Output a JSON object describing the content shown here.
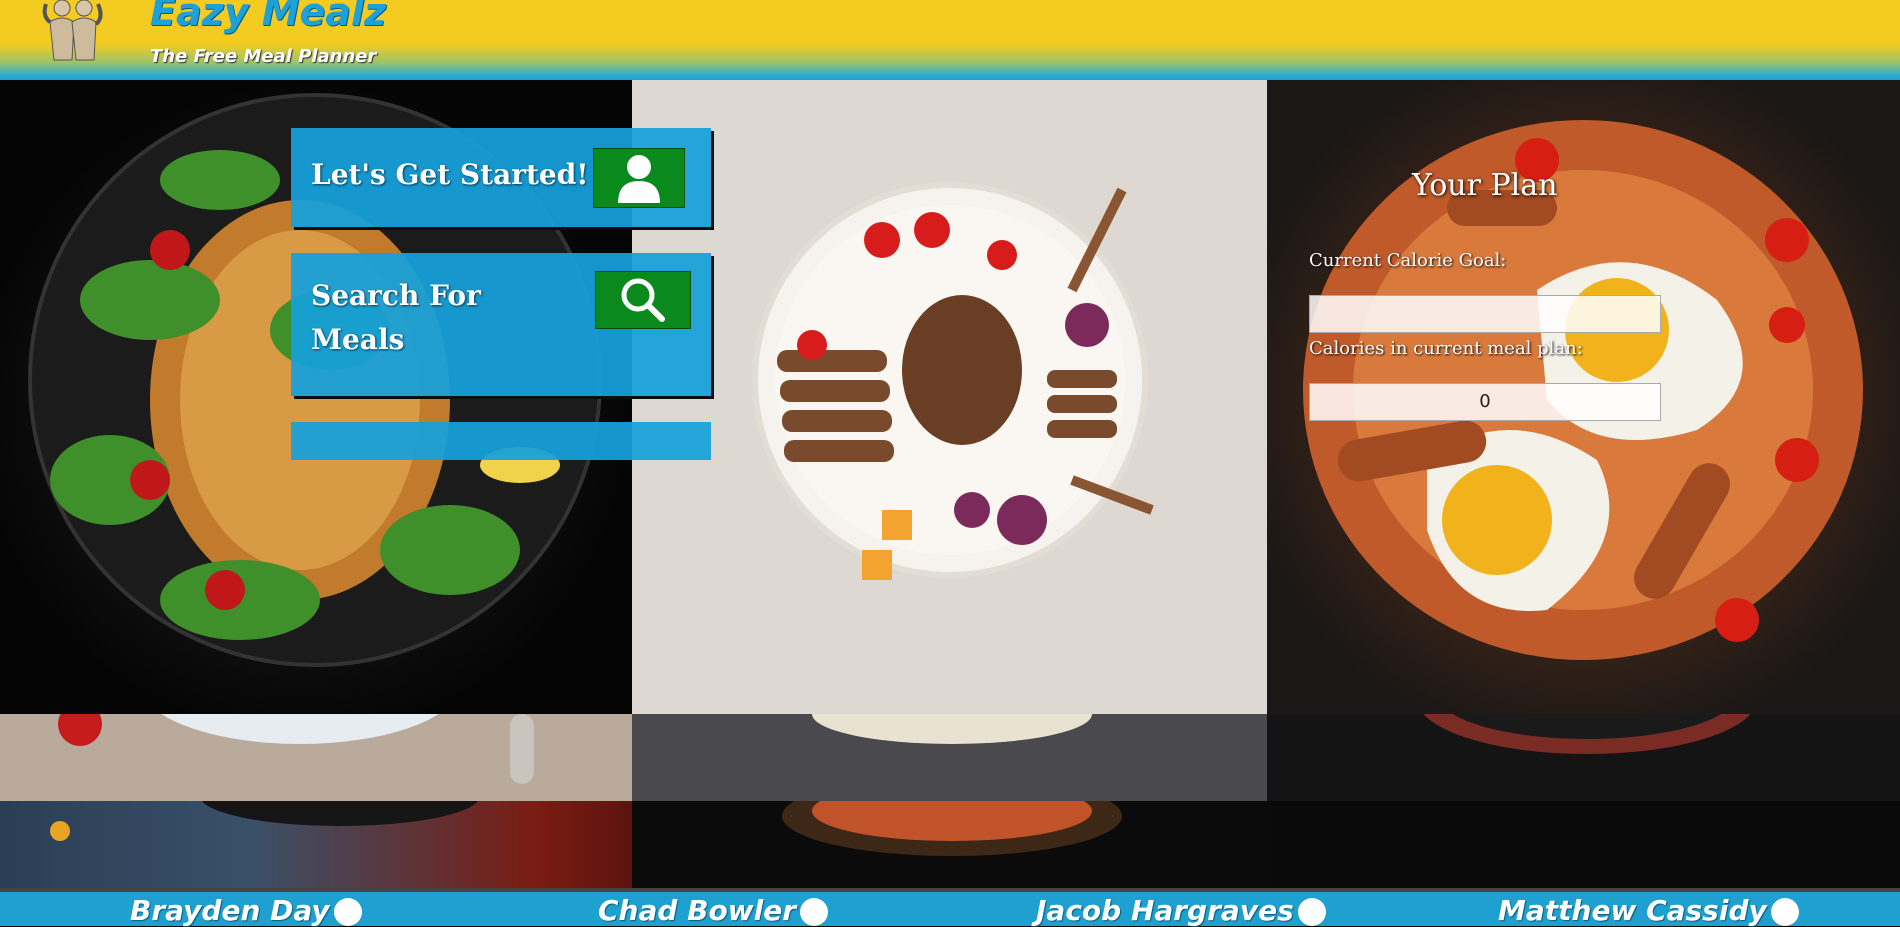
{
  "header": {
    "brand": "Eazy Mealz",
    "tagline": "The Free Meal Planner"
  },
  "actions": {
    "get_started_label": "Let's Get Started!",
    "search_label_line1": "Search For",
    "search_label_line2": "Meals"
  },
  "plan": {
    "title": "Your Plan",
    "calorie_goal_label": "Current Calorie Goal:",
    "calorie_goal_value": "",
    "plan_calories_label": "Calories in current meal plan:",
    "plan_calories_value": "0"
  },
  "footer": {
    "authors": [
      "Brayden Day",
      "Chad Bowler",
      "Jacob Hargraves",
      "Matthew Cassidy"
    ]
  },
  "icons": {
    "user": "user-icon",
    "search": "search-icon",
    "github": "github-icon",
    "logo": "bodybuilder-logo"
  },
  "colors": {
    "header_yellow": "#f3cb21",
    "accent_blue": "#16a0da",
    "button_green": "#0a8a1c",
    "footer_blue": "#1ea1d0"
  }
}
